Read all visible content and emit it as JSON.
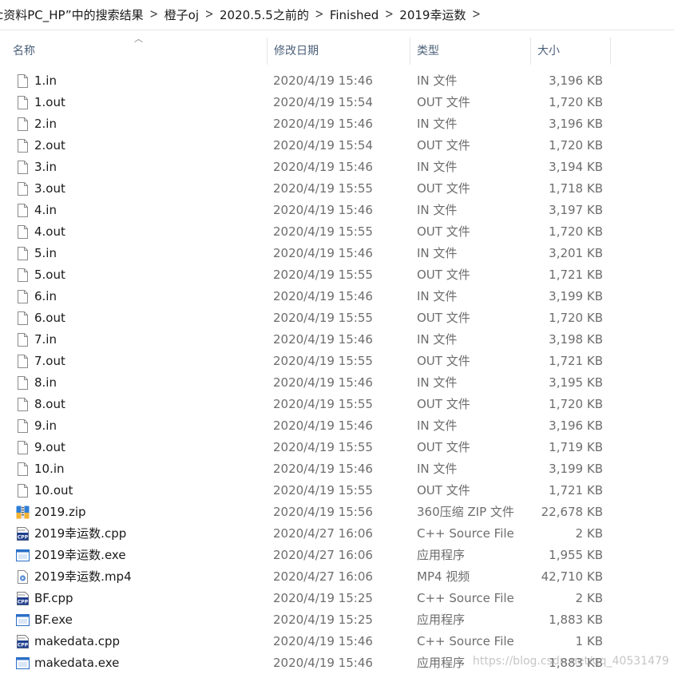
{
  "breadcrumb": [
    "c资料PC_HP”中的搜索结果",
    "橙子oj",
    "2020.5.5之前的",
    "Finished",
    "2019幸运数"
  ],
  "columns": {
    "name": "名称",
    "date": "修改日期",
    "type": "类型",
    "size": "大小"
  },
  "files": [
    {
      "name": "1.in",
      "date": "2020/4/19 15:46",
      "type": "IN 文件",
      "size": "3,196 KB",
      "icon": "blank-file-icon"
    },
    {
      "name": "1.out",
      "date": "2020/4/19 15:54",
      "type": "OUT 文件",
      "size": "1,720 KB",
      "icon": "blank-file-icon"
    },
    {
      "name": "2.in",
      "date": "2020/4/19 15:46",
      "type": "IN 文件",
      "size": "3,196 KB",
      "icon": "blank-file-icon"
    },
    {
      "name": "2.out",
      "date": "2020/4/19 15:54",
      "type": "OUT 文件",
      "size": "1,720 KB",
      "icon": "blank-file-icon"
    },
    {
      "name": "3.in",
      "date": "2020/4/19 15:46",
      "type": "IN 文件",
      "size": "3,194 KB",
      "icon": "blank-file-icon"
    },
    {
      "name": "3.out",
      "date": "2020/4/19 15:55",
      "type": "OUT 文件",
      "size": "1,718 KB",
      "icon": "blank-file-icon"
    },
    {
      "name": "4.in",
      "date": "2020/4/19 15:46",
      "type": "IN 文件",
      "size": "3,197 KB",
      "icon": "blank-file-icon"
    },
    {
      "name": "4.out",
      "date": "2020/4/19 15:55",
      "type": "OUT 文件",
      "size": "1,720 KB",
      "icon": "blank-file-icon"
    },
    {
      "name": "5.in",
      "date": "2020/4/19 15:46",
      "type": "IN 文件",
      "size": "3,201 KB",
      "icon": "blank-file-icon"
    },
    {
      "name": "5.out",
      "date": "2020/4/19 15:55",
      "type": "OUT 文件",
      "size": "1,721 KB",
      "icon": "blank-file-icon"
    },
    {
      "name": "6.in",
      "date": "2020/4/19 15:46",
      "type": "IN 文件",
      "size": "3,199 KB",
      "icon": "blank-file-icon"
    },
    {
      "name": "6.out",
      "date": "2020/4/19 15:55",
      "type": "OUT 文件",
      "size": "1,720 KB",
      "icon": "blank-file-icon"
    },
    {
      "name": "7.in",
      "date": "2020/4/19 15:46",
      "type": "IN 文件",
      "size": "3,198 KB",
      "icon": "blank-file-icon"
    },
    {
      "name": "7.out",
      "date": "2020/4/19 15:55",
      "type": "OUT 文件",
      "size": "1,721 KB",
      "icon": "blank-file-icon"
    },
    {
      "name": "8.in",
      "date": "2020/4/19 15:46",
      "type": "IN 文件",
      "size": "3,195 KB",
      "icon": "blank-file-icon"
    },
    {
      "name": "8.out",
      "date": "2020/4/19 15:55",
      "type": "OUT 文件",
      "size": "1,720 KB",
      "icon": "blank-file-icon"
    },
    {
      "name": "9.in",
      "date": "2020/4/19 15:46",
      "type": "IN 文件",
      "size": "3,196 KB",
      "icon": "blank-file-icon"
    },
    {
      "name": "9.out",
      "date": "2020/4/19 15:55",
      "type": "OUT 文件",
      "size": "1,719 KB",
      "icon": "blank-file-icon"
    },
    {
      "name": "10.in",
      "date": "2020/4/19 15:46",
      "type": "IN 文件",
      "size": "3,199 KB",
      "icon": "blank-file-icon"
    },
    {
      "name": "10.out",
      "date": "2020/4/19 15:55",
      "type": "OUT 文件",
      "size": "1,721 KB",
      "icon": "blank-file-icon"
    },
    {
      "name": "2019.zip",
      "date": "2020/4/19 15:56",
      "type": "360压缩 ZIP 文件",
      "size": "22,678 KB",
      "icon": "zip-archive-icon"
    },
    {
      "name": "2019幸运数.cpp",
      "date": "2020/4/27 16:06",
      "type": "C++ Source File",
      "size": "2 KB",
      "icon": "cpp-file-icon"
    },
    {
      "name": "2019幸运数.exe",
      "date": "2020/4/27 16:06",
      "type": "应用程序",
      "size": "1,955 KB",
      "icon": "exe-app-icon"
    },
    {
      "name": "2019幸运数.mp4",
      "date": "2020/4/27 16:06",
      "type": "MP4 视频",
      "size": "42,710 KB",
      "icon": "video-file-icon"
    },
    {
      "name": "BF.cpp",
      "date": "2020/4/19 15:25",
      "type": "C++ Source File",
      "size": "2 KB",
      "icon": "cpp-file-icon"
    },
    {
      "name": "BF.exe",
      "date": "2020/4/19 15:25",
      "type": "应用程序",
      "size": "1,883 KB",
      "icon": "exe-app-icon"
    },
    {
      "name": "makedata.cpp",
      "date": "2020/4/19 15:46",
      "type": "C++ Source File",
      "size": "1 KB",
      "icon": "cpp-file-icon"
    },
    {
      "name": "makedata.exe",
      "date": "2020/4/19 15:46",
      "type": "应用程序",
      "size": "1,883 KB",
      "icon": "exe-app-icon"
    }
  ],
  "watermark": "https://blog.csdn.net/qq_40531479",
  "colors": {
    "header_text": "#4c607a",
    "meta_text": "#6d6d6d",
    "zip_icon": "#2f7fd8",
    "cpp_badge": "#1f3f8f",
    "exe_frame": "#2b6fc8"
  }
}
